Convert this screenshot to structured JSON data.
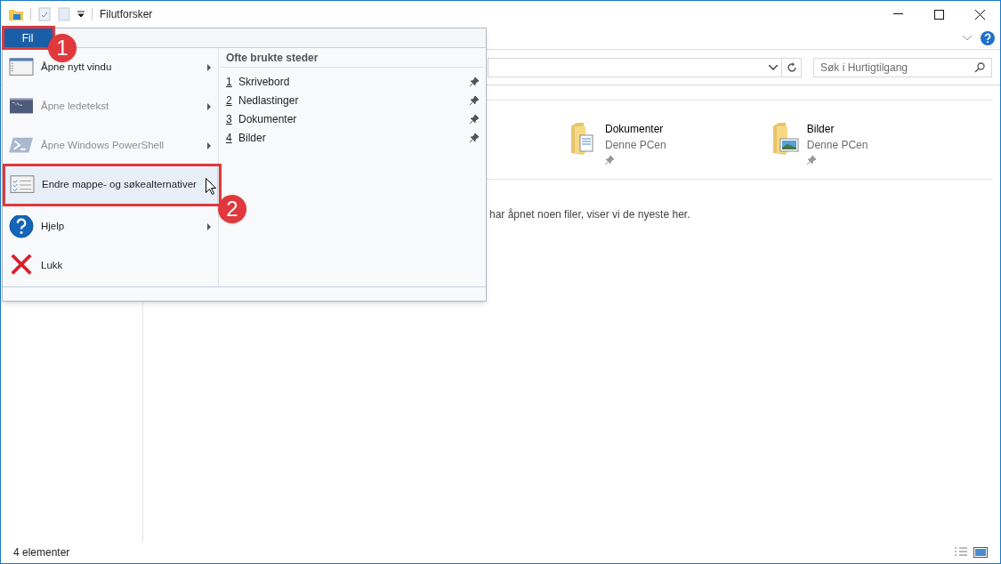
{
  "window": {
    "title": "Filutforsker"
  },
  "search": {
    "placeholder": "Søk i Hurtigtilgang"
  },
  "folders": [
    {
      "name": "Dokumenter",
      "location": "Denne PCen",
      "kind": "documents"
    },
    {
      "name": "Bilder",
      "location": "Denne PCen",
      "kind": "pictures"
    }
  ],
  "recent_hint": "har åpnet noen filer, viser vi de nyeste her.",
  "status_bar": {
    "count": "4 elementer"
  },
  "file_menu": {
    "tab": "Fil",
    "items": [
      {
        "kind": "window",
        "label": "Åpne nytt vindu",
        "disabled": false,
        "submenu": true,
        "highlighted": false
      },
      {
        "kind": "cmd",
        "label": "Åpne ledetekst",
        "disabled": true,
        "submenu": true,
        "highlighted": false
      },
      {
        "kind": "powershell",
        "label": "Åpne Windows PowerShell",
        "disabled": true,
        "submenu": true,
        "highlighted": false
      },
      {
        "kind": "options",
        "label": "Endre mappe- og søkealternativer",
        "disabled": false,
        "submenu": false,
        "highlighted": true
      },
      {
        "kind": "help",
        "label": "Hjelp",
        "disabled": false,
        "submenu": true,
        "highlighted": false
      },
      {
        "kind": "close",
        "label": "Lukk",
        "disabled": false,
        "submenu": false,
        "highlighted": false
      }
    ],
    "frequent_title": "Ofte brukte steder",
    "frequent": [
      {
        "number": "1",
        "name": "Skrivebord"
      },
      {
        "number": "2",
        "name": "Nedlastinger"
      },
      {
        "number": "3",
        "name": "Dokumenter"
      },
      {
        "number": "4",
        "name": "Bilder"
      }
    ]
  },
  "callouts": [
    {
      "number": "1"
    },
    {
      "number": "2"
    }
  ]
}
